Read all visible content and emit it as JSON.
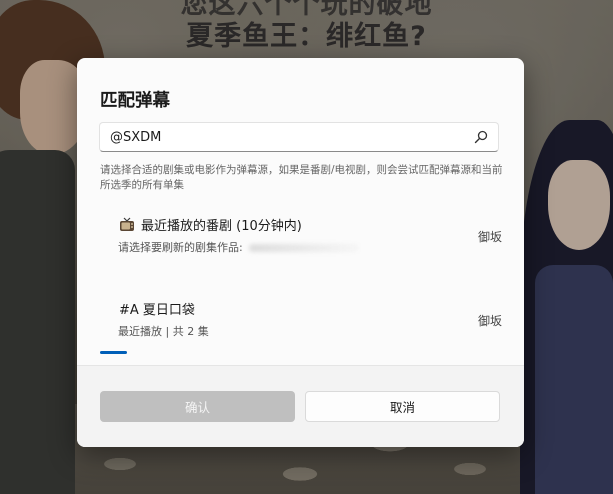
{
  "background": {
    "video_title_line1": "您这六个个玩的破地",
    "video_title_line2": "夏季鱼王：绯红鱼?"
  },
  "dialog": {
    "title": "匹配弹幕",
    "search": {
      "value": "@SXDM",
      "icon": "search-icon"
    },
    "hint": "请选择合适的剧集或电影作为弹幕源，如果是番剧/电视剧，则会尝试匹配弹幕源和当前所选季的所有单集",
    "results": [
      {
        "icon": "tv-icon",
        "title": "最近播放的番剧 (10分钟内)",
        "subtitle": "请选择要刷新的剧集作品:",
        "source": "御坂"
      },
      {
        "title": "#A 夏日口袋",
        "subtitle": "最近播放 | 共 2 集",
        "source": "御坂"
      }
    ],
    "buttons": {
      "confirm": "确认",
      "cancel": "取消"
    },
    "colors": {
      "accent": "#005fb8",
      "confirm_disabled": "#bfbfbf"
    }
  }
}
